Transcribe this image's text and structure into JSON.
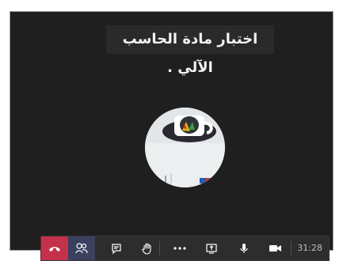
{
  "meeting": {
    "title": "اختبار مادة الحاسب الآلي ."
  },
  "toolbar": {
    "timer": "31:28",
    "hangup": "hang-up-icon",
    "participants": "participants-icon",
    "chat": "chat-icon",
    "raise_hand": "raise-hand-icon",
    "more": "more-options-icon",
    "share": "share-screen-icon",
    "mic": "microphone-icon",
    "video": "camera-icon"
  }
}
